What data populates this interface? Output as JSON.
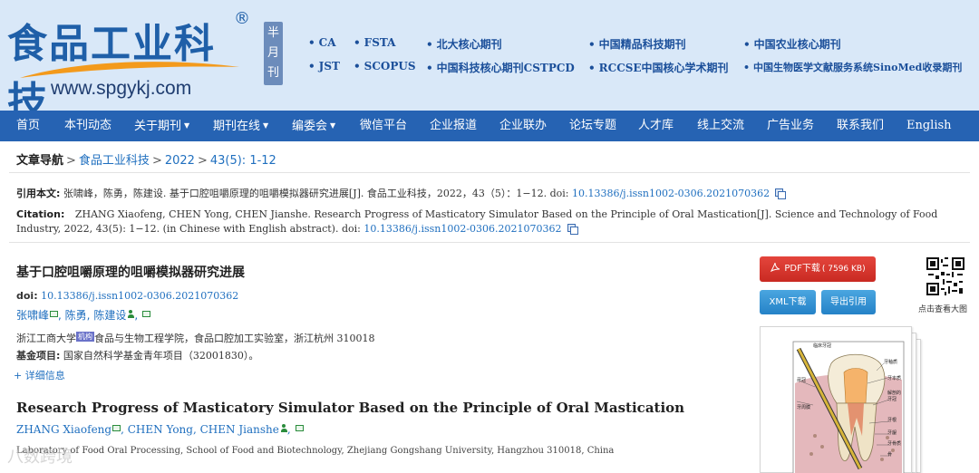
{
  "header": {
    "logo_cn": "食品工业科技",
    "logo_reg": "®",
    "logo_url": "www.spgykj.com",
    "frequency": [
      "半",
      "月",
      "刊"
    ],
    "indexes_row1": [
      "CA",
      "FSTA",
      "北大核心期刊",
      "中国精品科技期刊",
      "中国农业核心期刊"
    ],
    "indexes_row2": [
      "JST",
      "SCOPUS",
      "中国科技核心期刊CSTPCD",
      "RCCSE中国核心学术期刊",
      "中国生物医学文献服务系统SinoMed收录期刊"
    ]
  },
  "nav": {
    "items": [
      "首页",
      "本刊动态",
      "关于期刊",
      "期刊在线",
      "编委会",
      "微信平台",
      "企业报道",
      "企业联办",
      "论坛专题",
      "人才库",
      "线上交流",
      "广告业务",
      "联系我们",
      "English"
    ]
  },
  "breadcrumb": {
    "label": "文章导航",
    "journal": "食品工业科技",
    "year": "2022",
    "issue": "43(5): 1-12"
  },
  "citation": {
    "cn_label": "引用本文:",
    "cn_text": "张啸峰，陈勇，陈建设. 基于口腔咀嚼原理的咀嚼模拟器研究进展[J]. 食品工业科技，2022，43（5）：1−12. doi: ",
    "en_label": "Citation:",
    "en_text": "ZHANG Xiaofeng, CHEN Yong, CHEN Jianshe. Research Progress of Masticatory Simulator Based on the Principle of Oral Mastication[J]. Science and Technology of Food Industry, 2022, 43(5): 1−12. (in Chinese with English abstract). doi: ",
    "doi": "10.13386/j.issn1002-0306.2021070362"
  },
  "article": {
    "title_cn": "基于口腔咀嚼原理的咀嚼模拟器研究进展",
    "doi_label": "doi:",
    "doi": "10.13386/j.issn1002-0306.2021070362",
    "authors_cn": [
      "张啸峰",
      "陈勇",
      "陈建设"
    ],
    "affil_cn_univ": "浙江工商大学",
    "affil_badge": "机构",
    "affil_cn_rest": "食品与生物工程学院，食品口腔加工实验室，浙江杭州 310018",
    "fund_label": "基金项目:",
    "fund_text": "国家自然科学基金青年项目（32001830）。",
    "details_link": "+ 详细信息",
    "title_en": "Research Progress of Masticatory Simulator Based on the Principle of Oral Mastication",
    "authors_en": [
      "ZHANG Xiaofeng",
      "CHEN Yong",
      "CHEN Jianshe"
    ],
    "affil_en": "Laboratory of Food Oral Processing, School of Food and Biotechnology, Zhejiang Gongshang University, Hangzhou 310018, China"
  },
  "sidebar": {
    "pdf_label": "PDF下载",
    "pdf_size": "( 7596 KB)",
    "xml_label": "XML下载",
    "export_label": "导出引用",
    "qr_caption": "点击查看大图"
  },
  "figure_labels": {
    "top_left": "临床牙冠",
    "left_mid": "牙冠",
    "left_low": "牙周膜",
    "right_top": "牙釉质",
    "right_1": "牙本质",
    "right_2": "解剖的",
    "right_3": "牙冠",
    "right_4": "牙根",
    "right_5": "牙龈",
    "right_6": "牙骨质",
    "right_7": "骨"
  },
  "watermark": "八数跨境",
  "colors": {
    "header_bg": "#d9e8f8",
    "nav_bg": "#2663b3",
    "link": "#1f6fbf",
    "pdf_button": "#d8342b",
    "blue_button": "#2f8fd3"
  }
}
